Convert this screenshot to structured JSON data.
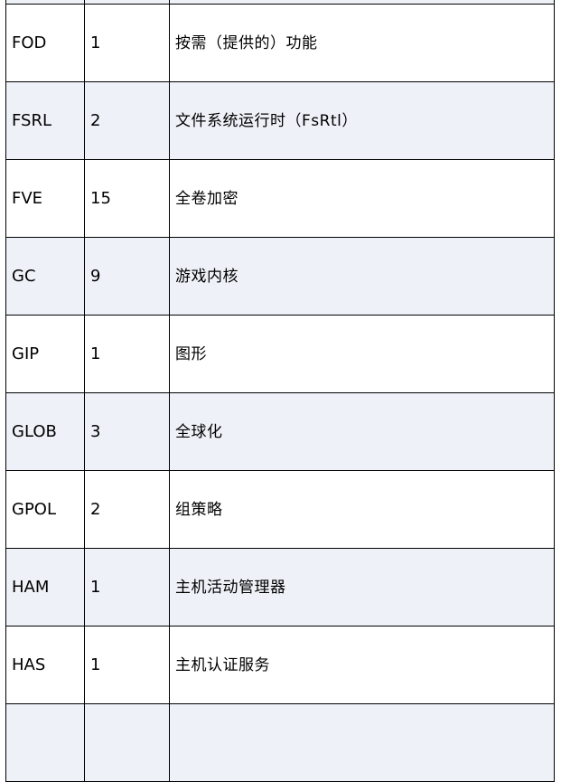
{
  "rows": [
    {
      "code": "",
      "count": "",
      "description": ""
    },
    {
      "code": "FOD",
      "count": "1",
      "description": "按需（提供的）功能"
    },
    {
      "code": "FSRL",
      "count": "2",
      "description": "文件系统运行时（FsRtl）"
    },
    {
      "code": "FVE",
      "count": "15",
      "description": "全卷加密"
    },
    {
      "code": "GC",
      "count": "9",
      "description": "游戏内核"
    },
    {
      "code": "GIP",
      "count": "1",
      "description": "图形"
    },
    {
      "code": "GLOB",
      "count": "3",
      "description": "全球化"
    },
    {
      "code": "GPOL",
      "count": "2",
      "description": "组策略"
    },
    {
      "code": "HAM",
      "count": "1",
      "description": "主机活动管理器"
    },
    {
      "code": "HAS",
      "count": "1",
      "description": "主机认证服务"
    },
    {
      "code": "",
      "count": "",
      "description": ""
    }
  ],
  "colors": {
    "shaded_row": "#eef2f8",
    "border": "#000000",
    "text": "#000000"
  }
}
